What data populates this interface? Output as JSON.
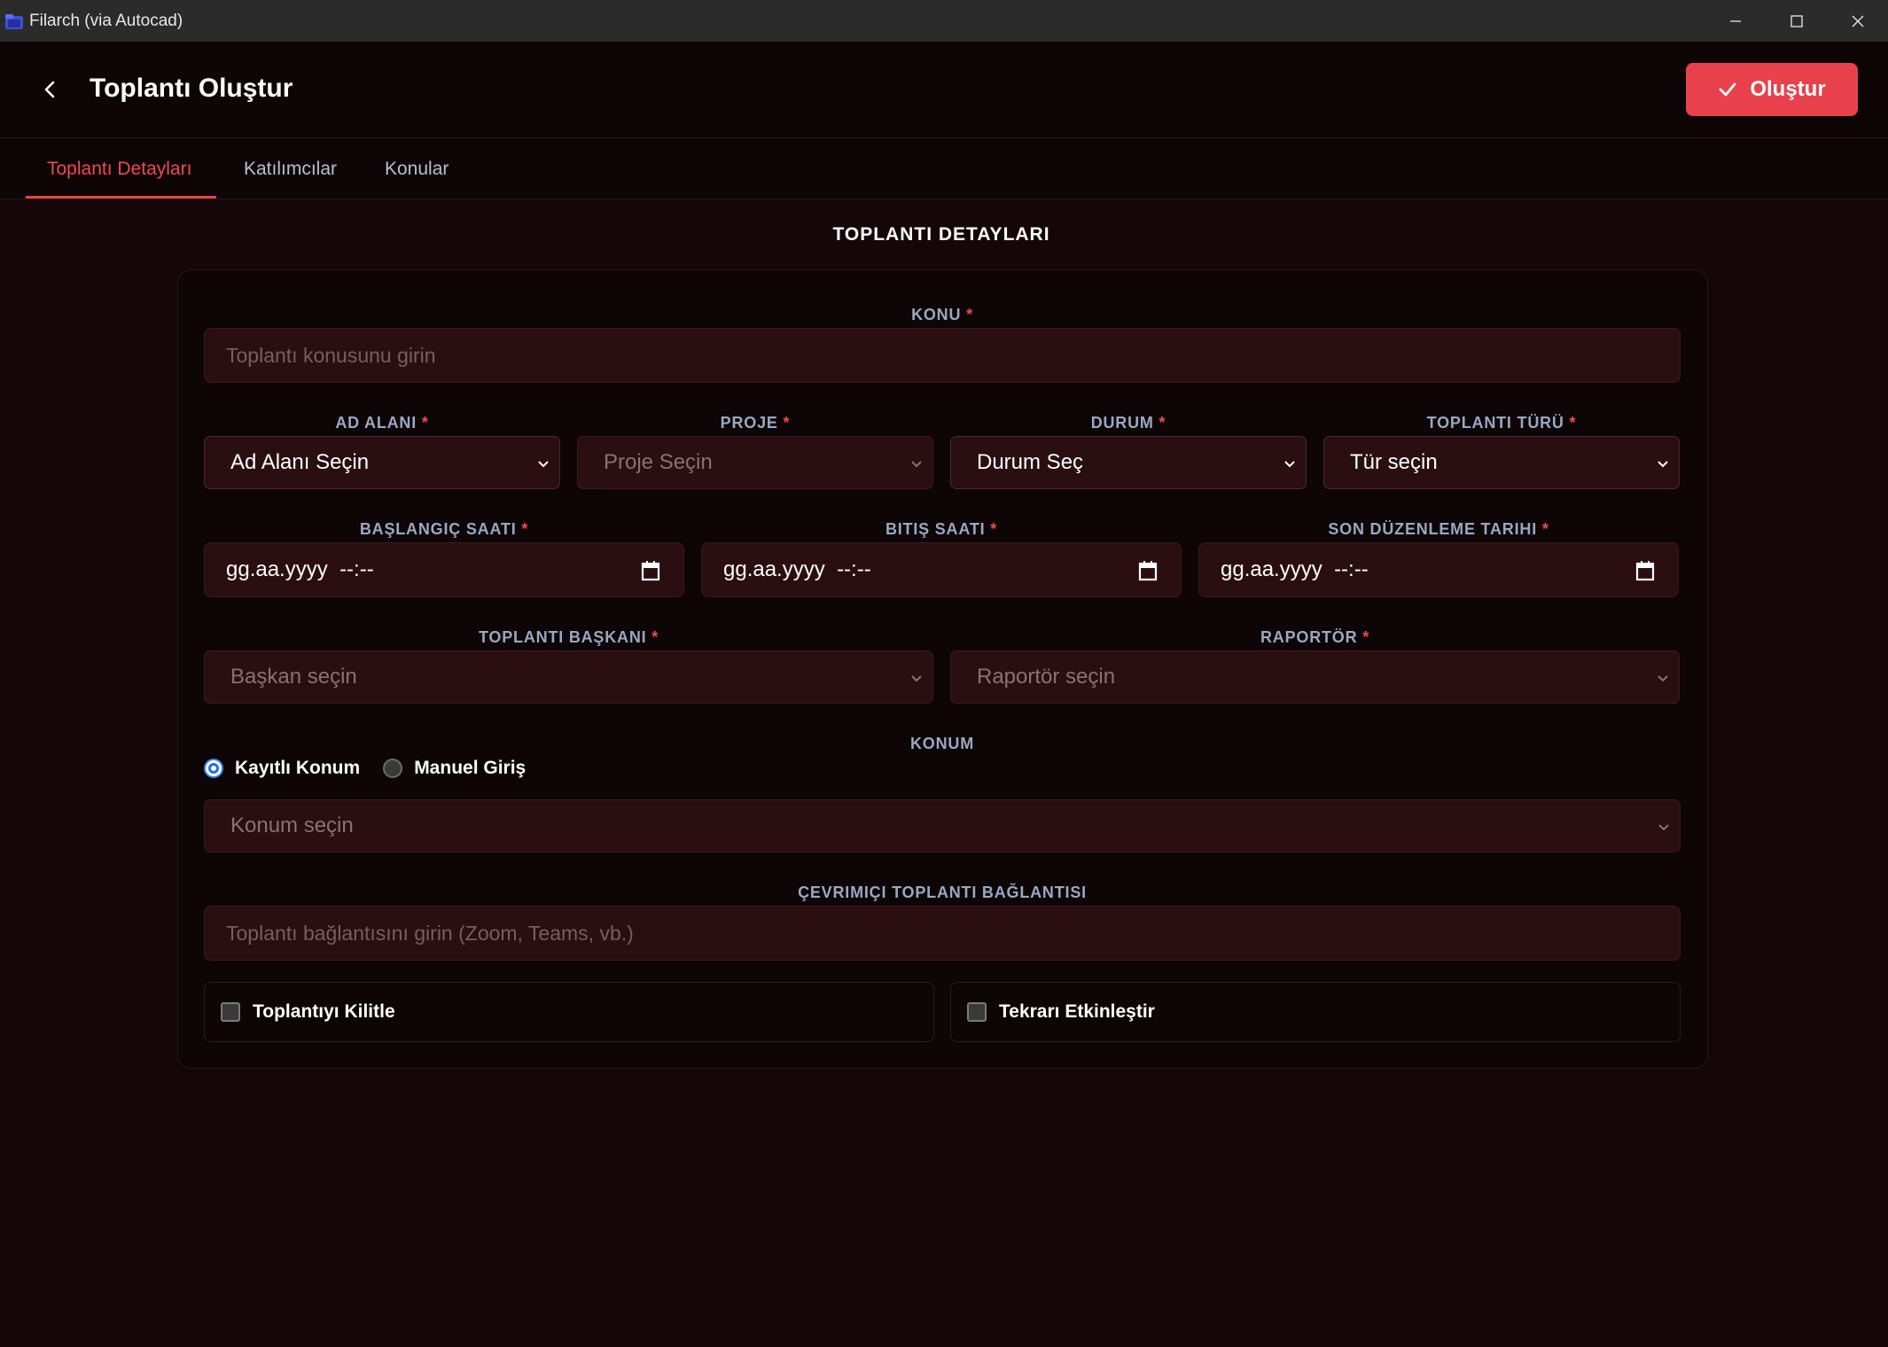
{
  "window": {
    "title": "Filarch (via Autocad)"
  },
  "header": {
    "title": "Toplantı Oluştur",
    "create_label": "Oluştur"
  },
  "tabs": [
    {
      "label": "Toplantı Detayları",
      "active": true
    },
    {
      "label": "Katılımcılar",
      "active": false
    },
    {
      "label": "Konular",
      "active": false
    }
  ],
  "section": {
    "heading": "TOPLANTI DETAYLARI"
  },
  "form": {
    "subject": {
      "label": "KONU",
      "required": "*",
      "placeholder": "Toplantı konusunu girin"
    },
    "namespace": {
      "label": "AD ALANI",
      "required": "*",
      "value": "Ad Alanı Seçin"
    },
    "project": {
      "label": "PROJE",
      "required": "*",
      "value": "Proje Seçin"
    },
    "status": {
      "label": "DURUM",
      "required": "*",
      "value": "Durum Seç"
    },
    "meeting_type": {
      "label": "TOPLANTI TÜRÜ",
      "required": "*",
      "value": "Tür seçin"
    },
    "start_time": {
      "label": "BAŞLANGIÇ SAATI",
      "required": "*",
      "value": "gg.aa.yyyy  --:--"
    },
    "end_time": {
      "label": "BITIŞ SAATI",
      "required": "*",
      "value": "gg.aa.yyyy  --:--"
    },
    "last_edit": {
      "label": "SON DÜZENLEME TARIHI",
      "required": "*",
      "value": "gg.aa.yyyy  --:--"
    },
    "chair": {
      "label": "TOPLANTI BAŞKANI",
      "required": "*",
      "value": "Başkan seçin"
    },
    "reporter": {
      "label": "RAPORTÖR",
      "required": "*",
      "value": "Raportör seçin"
    },
    "location": {
      "label": "KONUM",
      "radio_saved": "Kayıtlı Konum",
      "radio_manual": "Manuel Giriş",
      "selected": "saved",
      "value": "Konum seçin"
    },
    "online_link": {
      "label": "ÇEVRIMIÇI TOPLANTI BAĞLANTISI",
      "placeholder": "Toplantı bağlantısını girin (Zoom, Teams, vb.)"
    },
    "lock_meeting": {
      "label": "Toplantıyı Kilitle",
      "checked": false
    },
    "enable_recurrence": {
      "label": "Tekrarı Etkinleştir",
      "checked": false
    }
  },
  "colors": {
    "accent": "#e8414b",
    "background": "#150709",
    "field_bg": "#2a0e12",
    "label": "#9aa8c2"
  }
}
